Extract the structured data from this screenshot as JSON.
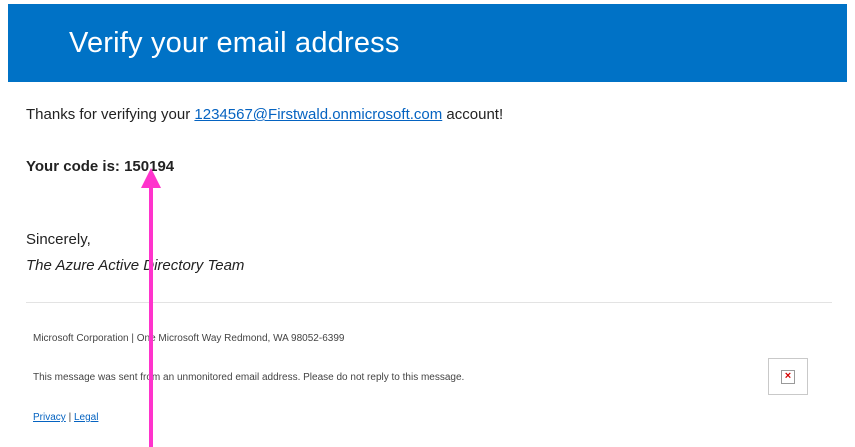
{
  "header": {
    "title": "Verify your email address"
  },
  "body": {
    "thanks_prefix": "Thanks for verifying your",
    "account_link": "1234567@Firstwald.onmicrosoft.com",
    "thanks_suffix": "account!",
    "code_line": "Your code is: 150194",
    "sincerely": "Sincerely,",
    "team": "The Azure Active Directory Team"
  },
  "footer": {
    "corp": "Microsoft Corporation | One Microsoft Way Redmond, WA 98052-6399",
    "notice": "This message was sent from an unmonitored email address. Please do not reply to this message.",
    "privacy_label": "Privacy",
    "separator": "|",
    "legal_label": "Legal",
    "image_icon": "broken-image-icon"
  },
  "annotation": {
    "color": "#ff33cc",
    "icon": "arrow-up-icon"
  },
  "colors": {
    "header_bg": "#0072c6",
    "link": "#0563c1"
  }
}
